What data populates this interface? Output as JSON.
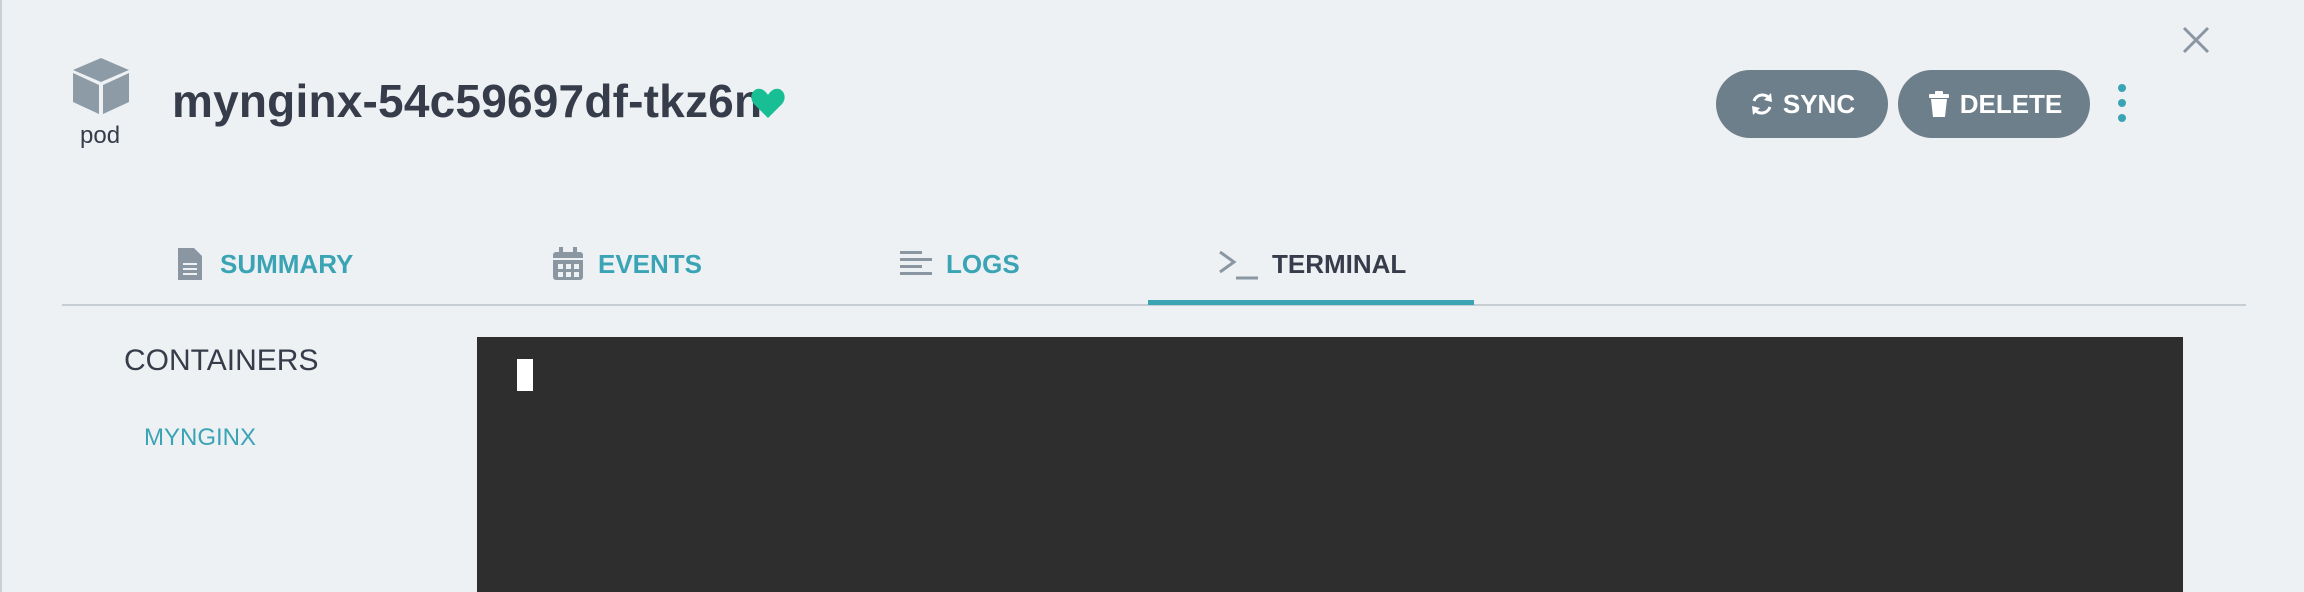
{
  "header": {
    "resource_kind": "pod",
    "resource_name": "mynginx-54c59697df-tkz6n",
    "health_icon": "heart-icon",
    "health_color": "#18be94",
    "sync_label": "SYNC",
    "delete_label": "DELETE"
  },
  "tabs": [
    {
      "label": "SUMMARY",
      "icon": "document-icon",
      "active": false
    },
    {
      "label": "EVENTS",
      "icon": "calendar-icon",
      "active": false
    },
    {
      "label": "LOGS",
      "icon": "lines-icon",
      "active": false
    },
    {
      "label": "TERMINAL",
      "icon": "terminal-icon",
      "active": true
    }
  ],
  "sidebar": {
    "heading": "CONTAINERS",
    "items": [
      {
        "label": "MYNGINX"
      }
    ]
  },
  "terminal": {
    "background": "#2e2e2e",
    "content": ""
  },
  "colors": {
    "accent": "#3aa4b5",
    "button": "#6d7f8b",
    "background": "#edf1f4"
  }
}
